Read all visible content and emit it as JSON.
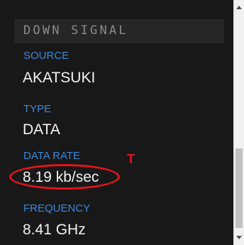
{
  "panel": {
    "header": "DOWN SIGNAL",
    "fields": [
      {
        "label": "SOURCE",
        "value": "AKATSUKI"
      },
      {
        "label": "TYPE",
        "value": "DATA"
      },
      {
        "label": "DATA RATE",
        "value": "8.19 kb/sec"
      },
      {
        "label": "FREQUENCY",
        "value": "8.41 GHz"
      }
    ]
  },
  "annotation": {
    "mark": "T",
    "color": "#e2141b"
  },
  "colors": {
    "background": "#181818",
    "header_bg": "#262626",
    "header_text": "#8a8a8a",
    "label": "#3d86d8",
    "value": "#f2f2f2"
  },
  "scrollbar": {
    "scroll_position": 0.71
  }
}
